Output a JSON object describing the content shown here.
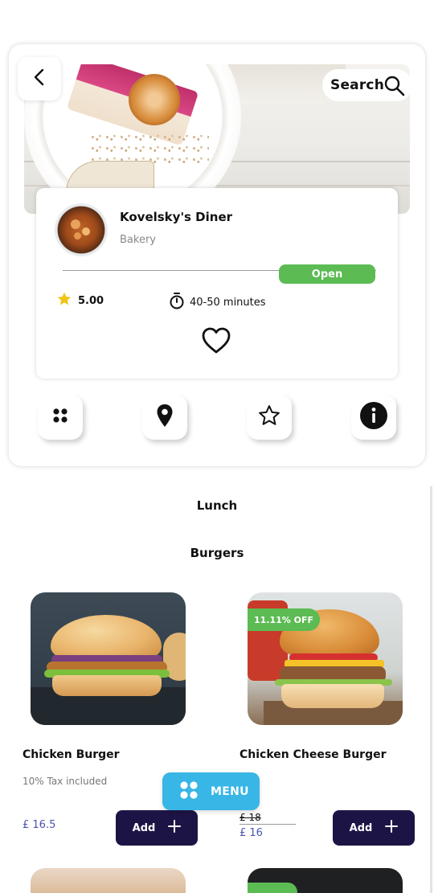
{
  "header": {
    "search_label": "Search"
  },
  "restaurant": {
    "name": "Kovelsky's Diner",
    "category": "Bakery",
    "status": "Open",
    "rating": "5.00",
    "delivery_time": "40-50 minutes"
  },
  "sections": {
    "menu_title": "Lunch",
    "category_title": "Burgers"
  },
  "products": [
    {
      "name": "Chicken Burger",
      "note": "10% Tax included",
      "price": "£ 16.5",
      "add_label": "Add"
    },
    {
      "name": "Chicken Cheese Burger",
      "badge": "11.11% OFF",
      "old_price": "£ 18",
      "price": "£ 16",
      "add_label": "Add"
    }
  ],
  "fab": {
    "label": "MENU"
  },
  "colors": {
    "open_green": "#5cbb53",
    "add_button_navy": "#1d1446",
    "menu_fab_blue": "#38b6e5",
    "price_blue": "#4b53b0",
    "star_yellow": "#f2c417"
  },
  "icons": {
    "back": "chevron-left-icon",
    "search": "search-icon",
    "star": "star-icon",
    "timer": "stopwatch-icon",
    "favorite": "heart-icon",
    "tabs": [
      "grid-icon",
      "location-pin-icon",
      "star-outline-icon",
      "info-icon"
    ],
    "add": "plus-icon",
    "menu": "grid-icon"
  }
}
